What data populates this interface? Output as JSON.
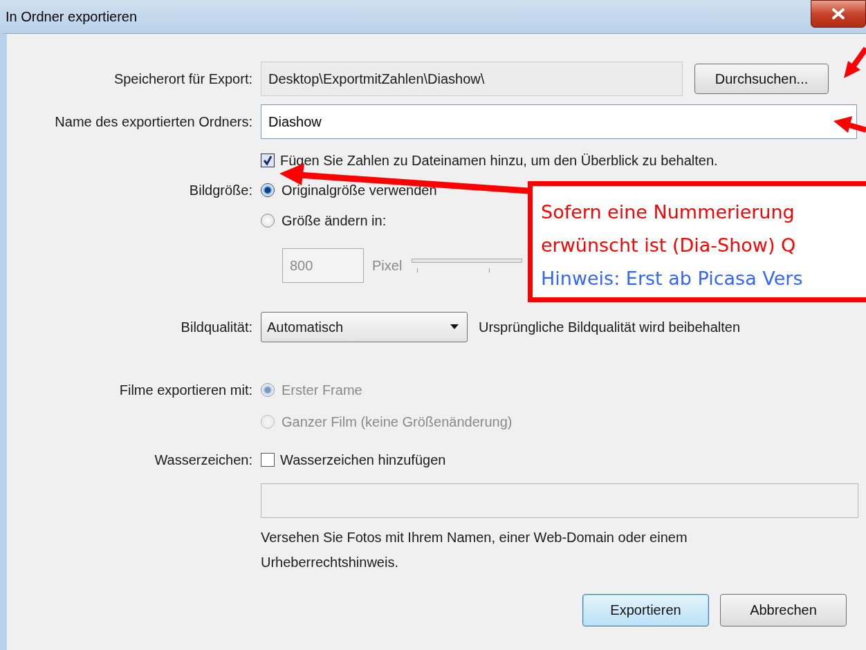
{
  "window": {
    "title": "In Ordner exportieren"
  },
  "location": {
    "label": "Speicherort für Export:",
    "value": "Desktop\\ExportmitZahlen\\Diashow\\",
    "button": "Durchsuchen..."
  },
  "folder_name": {
    "label": "Name des exportierten Ordners:",
    "value": "Diashow"
  },
  "numbering": {
    "label": "Fügen Sie Zahlen zu Dateinamen hinzu, um den Überblick zu behalten.",
    "checked": true
  },
  "image_size": {
    "label": "Bildgröße:",
    "options": [
      {
        "label": "Originalgröße verwenden",
        "selected": true
      },
      {
        "label": "Größe ändern in:",
        "selected": false
      }
    ],
    "pixel_value": "800",
    "unit": "Pixel",
    "disabled": true
  },
  "quality": {
    "label": "Bildqualität:",
    "value": "Automatisch",
    "note": "Ursprüngliche Bildqualität wird beibehalten"
  },
  "movies": {
    "label": "Filme exportieren mit:",
    "disabled": true,
    "options": [
      {
        "label": "Erster Frame",
        "selected": true
      },
      {
        "label": "Ganzer Film (keine Größenänderung)",
        "selected": false
      }
    ]
  },
  "watermark": {
    "label": "Wasserzeichen:",
    "checkbox_label": "Wasserzeichen hinzufügen",
    "checked": false,
    "hint": "Versehen Sie Fotos mit Ihrem Namen, einer Web-Domain oder einem Urheberrechtshinweis."
  },
  "buttons": [
    {
      "label": "Exportieren",
      "kind": "default"
    },
    {
      "label": "Abbrechen",
      "kind": "normal"
    }
  ],
  "annotation": {
    "lines": [
      {
        "text": "Sofern eine Nummerierung",
        "color": "#ff0000"
      },
      {
        "text": "erwünscht ist (Dia-Show) Q",
        "color": "#ff0000"
      },
      {
        "text": "Hinweis: Erst ab Picasa Vers",
        "color": "#3366ff"
      }
    ]
  }
}
